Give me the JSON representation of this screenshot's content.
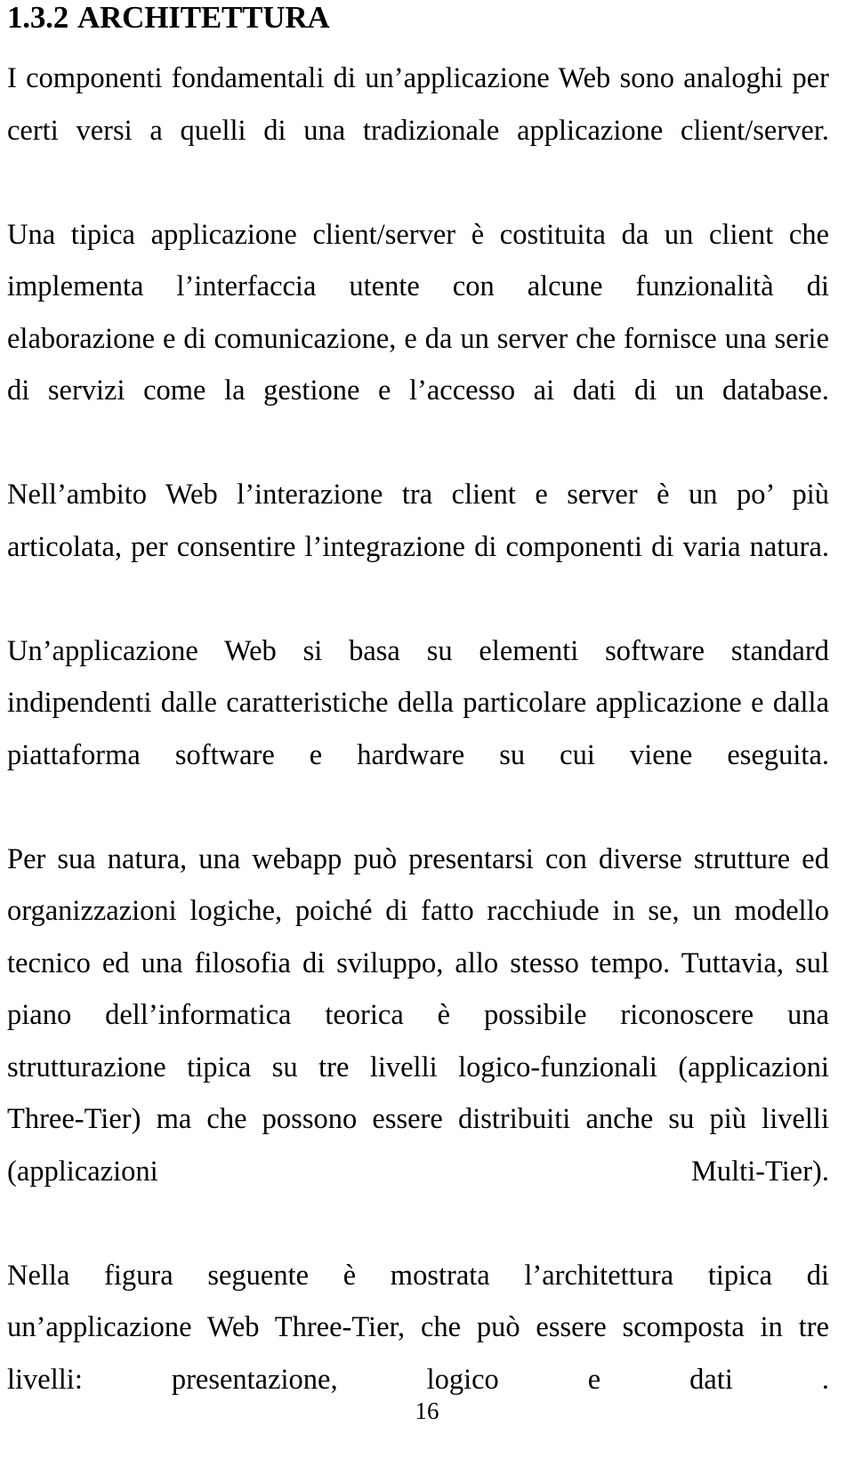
{
  "document": {
    "section_number": "1.3.2",
    "section_title": "ARCHITETTURA",
    "page_number": "16",
    "paragraphs": [
      "I componenti fondamentali di un’applicazione Web sono analoghi per certi versi a quelli di una tradizionale applicazione client/server.",
      "Una tipica applicazione client/server è costituita da un client che implementa l’interfaccia utente con alcune funzionalità di elaborazione e di comunicazione, e da un server che fornisce una serie di servizi come la gestione e l’accesso ai dati di un database.",
      "Nell’ambito Web l’interazione tra client e server è un po’ più articolata, per consentire l’integrazione di componenti di varia natura.",
      "Un’applicazione Web si basa su elementi software standard indipendenti dalle caratteristiche della particolare applicazione e dalla piattaforma software e hardware su cui viene eseguita.",
      "Per sua natura, una webapp può presentarsi con diverse strutture ed organizzazioni logiche, poiché di fatto racchiude in se, un modello tecnico ed una filosofia di sviluppo, allo stesso tempo. Tuttavia, sul piano dell’informatica teorica è possibile riconoscere una strutturazione tipica su tre livelli logico-funzionali (applicazioni Three-Tier) ma che possono essere distribuiti anche su più livelli (applicazioni Multi-Tier).",
      "Nella figura seguente è mostrata l’architettura tipica di un’applicazione Web Three-Tier, che può essere scomposta in tre livelli: presentazione, logico e dati ."
    ]
  }
}
